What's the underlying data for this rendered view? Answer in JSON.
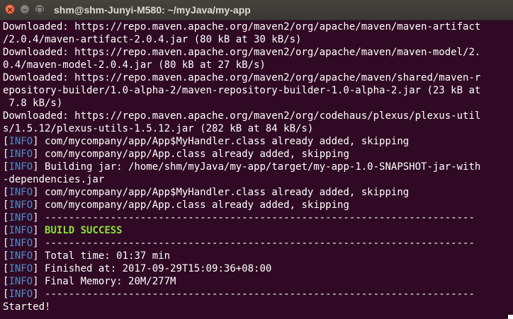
{
  "window": {
    "title": "shm@shm-Junyi-M580: ~/myJava/my-app",
    "close_glyph": "×",
    "min_glyph": "–"
  },
  "colors": {
    "background": "#300a24",
    "text": "#ffffff",
    "info_tag": "#4f8ec9",
    "success": "#8ae234"
  },
  "terminal": {
    "info_open": "[",
    "info_word": "INFO",
    "info_close": "]",
    "lines": [
      "Downloaded: https://repo.maven.apache.org/maven2/org/apache/maven/maven-artifact",
      "/2.0.4/maven-artifact-2.0.4.jar (80 kB at 30 kB/s)",
      "Downloaded: https://repo.maven.apache.org/maven2/org/apache/maven/maven-model/2.",
      "0.4/maven-model-2.0.4.jar (80 kB at 27 kB/s)",
      "Downloaded: https://repo.maven.apache.org/maven2/org/apache/maven/shared/maven-r",
      "epository-builder/1.0-alpha-2/maven-repository-builder-1.0-alpha-2.jar (23 kB at",
      " 7.8 kB/s)",
      "Downloaded: https://repo.maven.apache.org/maven2/org/codehaus/plexus/plexus-util",
      "s/1.5.12/plexus-utils-1.5.12.jar (282 kB at 84 kB/s)",
      " com/mycompany/app/App$MyHandler.class already added, skipping",
      " com/mycompany/app/App.class already added, skipping",
      " Building jar: /home/shm/myJava/my-app/target/my-app-1.0-SNAPSHOT-jar-with",
      "-dependencies.jar",
      " com/mycompany/app/App$MyHandler.class already added, skipping",
      " com/mycompany/app/App.class already added, skipping",
      " ------------------------------------------------------------------------",
      "BUILD SUCCESS",
      " ------------------------------------------------------------------------",
      " Total time: 01:37 min",
      " Finished at: 2017-09-29T15:09:36+08:00",
      " Final Memory: 20M/277M",
      " ------------------------------------------------------------------------",
      "Started!"
    ]
  }
}
